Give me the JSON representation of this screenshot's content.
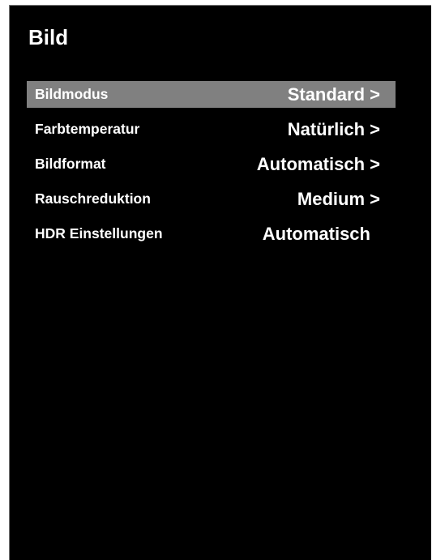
{
  "screen": {
    "title": "Bild"
  },
  "menu": {
    "items": [
      {
        "label": "Bildmodus",
        "value": "Standard >",
        "selected": true
      },
      {
        "label": "Farbtemperatur",
        "value": "Natürlich >",
        "selected": false
      },
      {
        "label": "Bildformat",
        "value": "Automatisch >",
        "selected": false
      },
      {
        "label": "Rauschreduktion",
        "value": "Medium >",
        "selected": false
      },
      {
        "label": "HDR Einstellungen",
        "value": "Automatisch",
        "selected": false
      }
    ]
  },
  "colors": {
    "background": "#000000",
    "highlight": "#808080",
    "text": "#ffffff"
  }
}
